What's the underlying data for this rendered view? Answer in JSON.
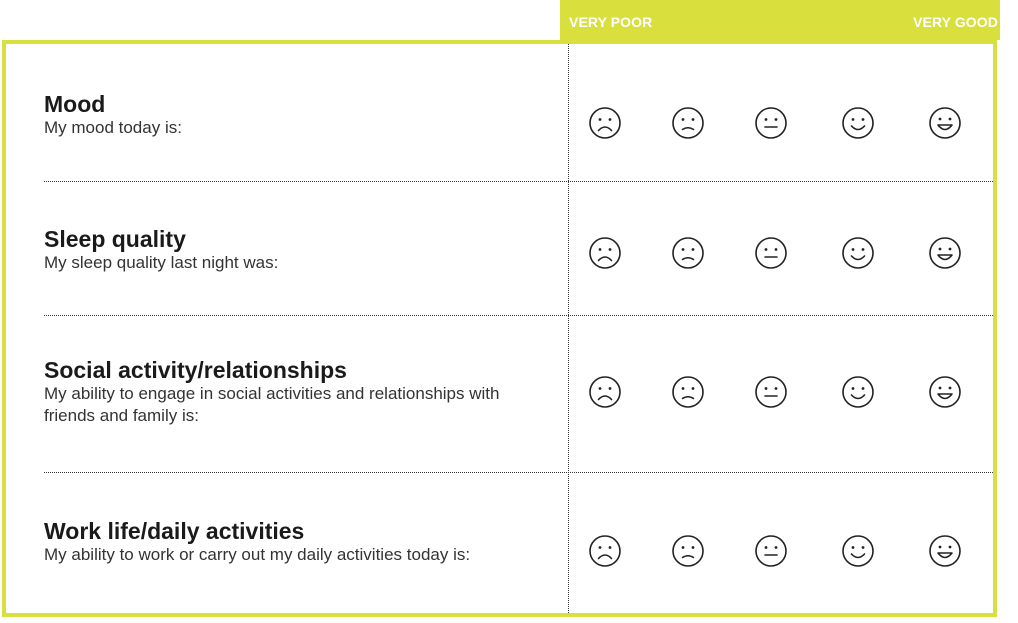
{
  "header": {
    "left_label": "VERY POOR",
    "right_label": "VERY GOOD",
    "accent_color": "#d9df3c"
  },
  "rows": [
    {
      "title": "Mood",
      "description": "My mood today is:"
    },
    {
      "title": "Sleep quality",
      "description": "My sleep quality last night was:"
    },
    {
      "title": "Social activity/relationships",
      "description": "My ability to engage in social activities and relationships with friends and family is:"
    },
    {
      "title": "Work life/daily activities",
      "description": "My ability to work or carry out my daily activities today is:"
    }
  ],
  "scale": [
    "very-sad-face-icon",
    "sad-face-icon",
    "neutral-face-icon",
    "smile-face-icon",
    "grin-face-icon"
  ]
}
